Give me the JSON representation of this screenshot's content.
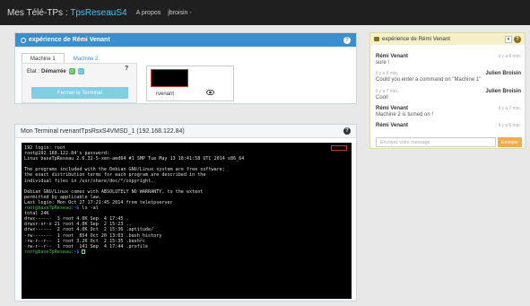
{
  "nav": {
    "brand_prefix": "Mes Télé-TPs : ",
    "brand_project": "TpsReseauS4",
    "links": [
      "A propos",
      "jbroisin -"
    ]
  },
  "experience": {
    "title": "expérience de Rémi Venant",
    "tabs": [
      "Machine 1",
      "Machine 2"
    ],
    "status_label": "Etat :",
    "status_value": "Démarrée",
    "qmark": "?",
    "close_button": "Fermer le Terminal",
    "vm_name": "rvenant"
  },
  "terminal_panel": {
    "title": "Mon Terminal rvenantTpsRsxS4VMSD_1 (192.168.122.84)",
    "lines": [
      {
        "t": "192 login: root"
      },
      {
        "t": "root@192.168.122.84's password:"
      },
      {
        "t": "Linux baseTpReseau 2.6.32-5-xen-amd64 #1 SMP Tue May 13 18:41:58 UTC 2014 x86_64"
      },
      {
        "t": ""
      },
      {
        "t": "The programs included with the Debian GNU/Linux system are free software;"
      },
      {
        "t": "the exact distribution terms for each program are described in the"
      },
      {
        "t": "individual files in /usr/share/doc/*/copyright."
      },
      {
        "t": ""
      },
      {
        "t": "Debian GNU/Linux comes with ABSOLUTELY NO WARRANTY, to the extent"
      },
      {
        "t": "permitted by applicable law."
      },
      {
        "t": "Last login: Mon Oct 27 17:21:45 2014 from teletpserver"
      },
      {
        "u": "root@baseTpReseau",
        "p": ":~$",
        "t": " ls -al"
      },
      {
        "t": "total 24K"
      },
      {
        "t": "drwx------  3 root 4.0K Sep  4 17:45 ."
      },
      {
        "t": "drwxr-xr-x 21 root 4.0K Sep  2 15:23 .."
      },
      {
        "t": "drwx------  2 root 4.0K Oct  2 15:36 .aptitude/"
      },
      {
        "t": "-rw-------  1 root  854 Oct 20 13:03 .bash_history"
      },
      {
        "t": "-rw-r--r--  1 root 3.2K Oct  2 15:35 .bashrc"
      },
      {
        "t": "-rw-r--r--  1 root  141 Sep  4 17:44 .profile"
      },
      {
        "u": "root@baseTpReseau",
        "p": ":~$",
        "t": " ",
        "cursor": true
      }
    ]
  },
  "chat": {
    "title": "expérience de Rémi Venant",
    "messages": [
      {
        "author": "Rémi Venant",
        "time": "il y a 8 min.",
        "text": "sure !",
        "align": "left"
      },
      {
        "author": "Julien Broisin",
        "time": "il y a 8 min.",
        "text": "Could you enter a command on \"Machine 1\"",
        "align": "right"
      },
      {
        "author": "Julien Broisin",
        "time": "il y a 7 min.",
        "text": "Cool!",
        "align": "right"
      },
      {
        "author": "Rémi Venant",
        "time": "il y a 7 min.",
        "text": "Machine 2 is turned on !",
        "align": "left"
      },
      {
        "author": "Rémi Venant",
        "time": "il y a 6 min.",
        "text": "",
        "align": "left"
      }
    ],
    "input_placeholder": "Envoyez votre message",
    "send_button": "Envoyer"
  },
  "colors": {
    "navbar": "#1f1f1f",
    "accent_blue": "#3a8fd0",
    "project_cyan": "#4ec0f0",
    "button_cyan": "#5bc0de",
    "send_orange": "#f0ad4e",
    "prompt_green": "#4ec04e",
    "chat_header": "#f5f0c8"
  }
}
